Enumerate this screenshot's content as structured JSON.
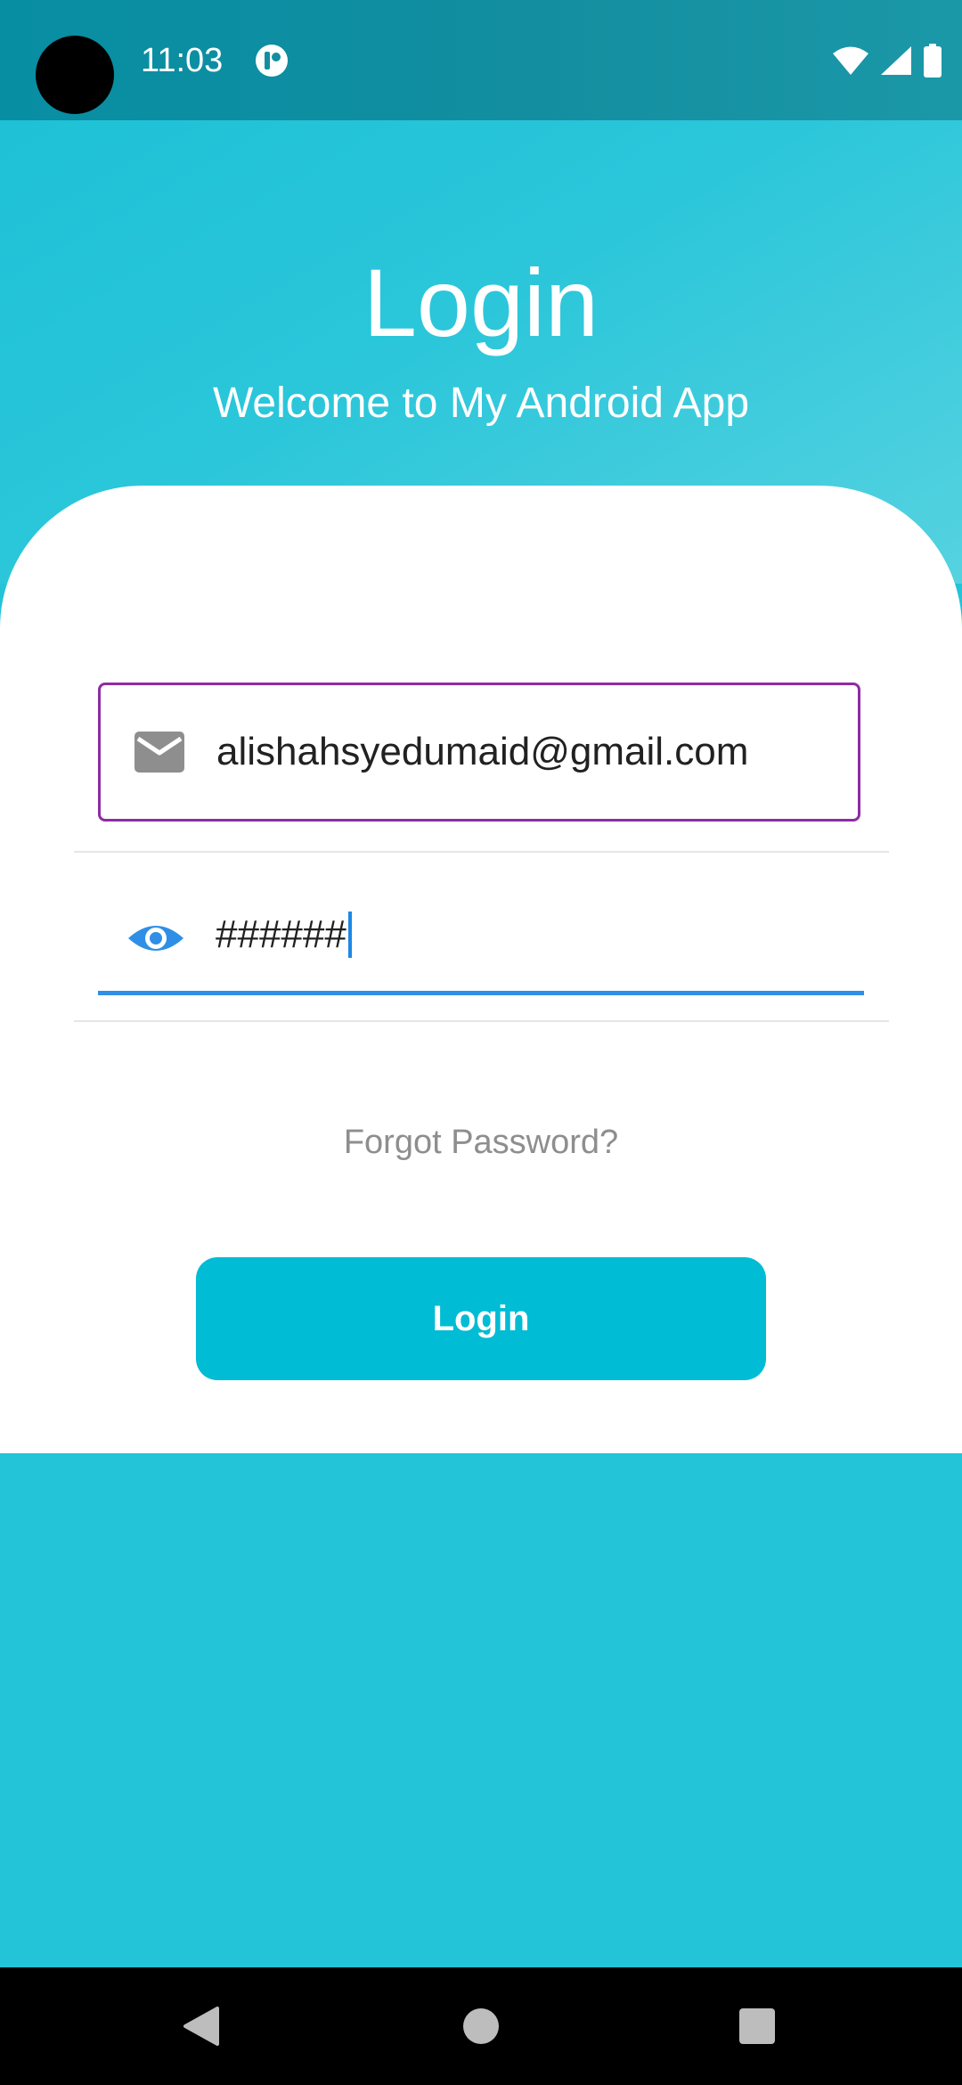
{
  "status_bar": {
    "time": "11:03",
    "icons": [
      "app-notification-icon",
      "wifi-icon",
      "signal-icon",
      "battery-icon"
    ]
  },
  "header": {
    "title": "Login",
    "subtitle": "Welcome to My Android App"
  },
  "form": {
    "email": {
      "value": "alishahsyedumaid@gmail.com",
      "icon": "email-icon"
    },
    "password": {
      "value": "######",
      "icon": "eye-icon"
    },
    "forgot_password_label": "Forgot Password?",
    "login_button_label": "Login"
  },
  "navigation": {
    "icons": [
      "back-icon",
      "home-icon",
      "recents-icon"
    ]
  },
  "colors": {
    "status_bar": "#0c8fa2",
    "header_start": "#1ec1d6",
    "header_end": "#55d2e0",
    "background": "#23c3d8",
    "card": "#ffffff",
    "email_border": "#8e2ca2",
    "password_underline": "#2f8fe6",
    "button": "#00bcd4",
    "forgot_text": "#8e8e8e"
  }
}
